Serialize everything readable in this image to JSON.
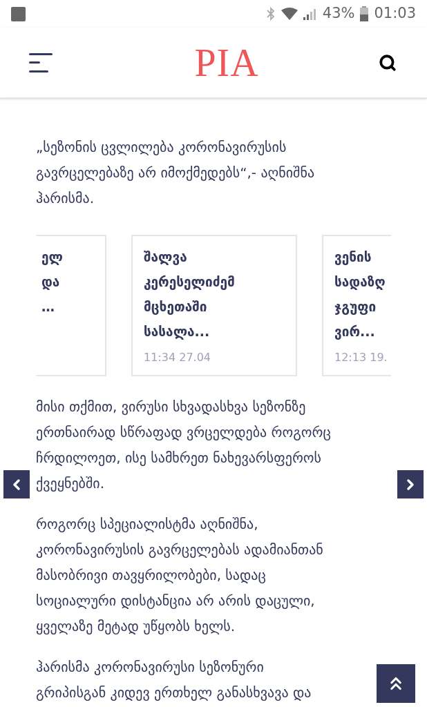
{
  "status_bar": {
    "battery": "43%",
    "time": "01:03"
  },
  "header": {
    "logo": "PIA"
  },
  "paragraphs_top": [
    {
      "lines": [
        "„სეზონის ცვლილება კორონავირუსის",
        "გავრცელებაზე არ იმოქმედებს“,- აღნიშნა",
        "ჰარისმა."
      ]
    }
  ],
  "carousel": [
    {
      "title_lines": [
        "ელ",
        "და",
        "…"
      ]
    },
    {
      "title_lines": [
        "შალვა",
        "კერესელიძემ",
        "მცხეთაში",
        "სასალა..."
      ],
      "time": "11:34 27.04"
    },
    {
      "title_lines": [
        "ვენის",
        "სადაზღ",
        "ჯგუფი",
        "ვირ..."
      ],
      "time": "12:13 19."
    }
  ],
  "paragraphs_bottom": [
    {
      "lines": [
        "მისი თქმით, ვირუსი სხვადასხვა სეზონზე",
        "ერთნაირად სწრაფად ვრცელდება როგორც",
        "ჩრდილოეთ, ისე სამხრეთ ნახევარსფეროს",
        "ქვეყნებში."
      ]
    },
    {
      "lines": [
        "როგორც სპეციალისტმა აღნიშნა,",
        "კორონავირუსის გავრცელებას ადამიანთან",
        "მასობრივი თავყრილობები, სადაც",
        "სოციალური დისტანცია არ არის დაცული,",
        "ყველაზე მეტად უწყობს ხელს."
      ]
    },
    {
      "lines": [
        "ჰარისმა კორონავირუსი სეზონური",
        "გრიპისგან კიდევ ერთხელ განასხვავა და"
      ]
    }
  ]
}
